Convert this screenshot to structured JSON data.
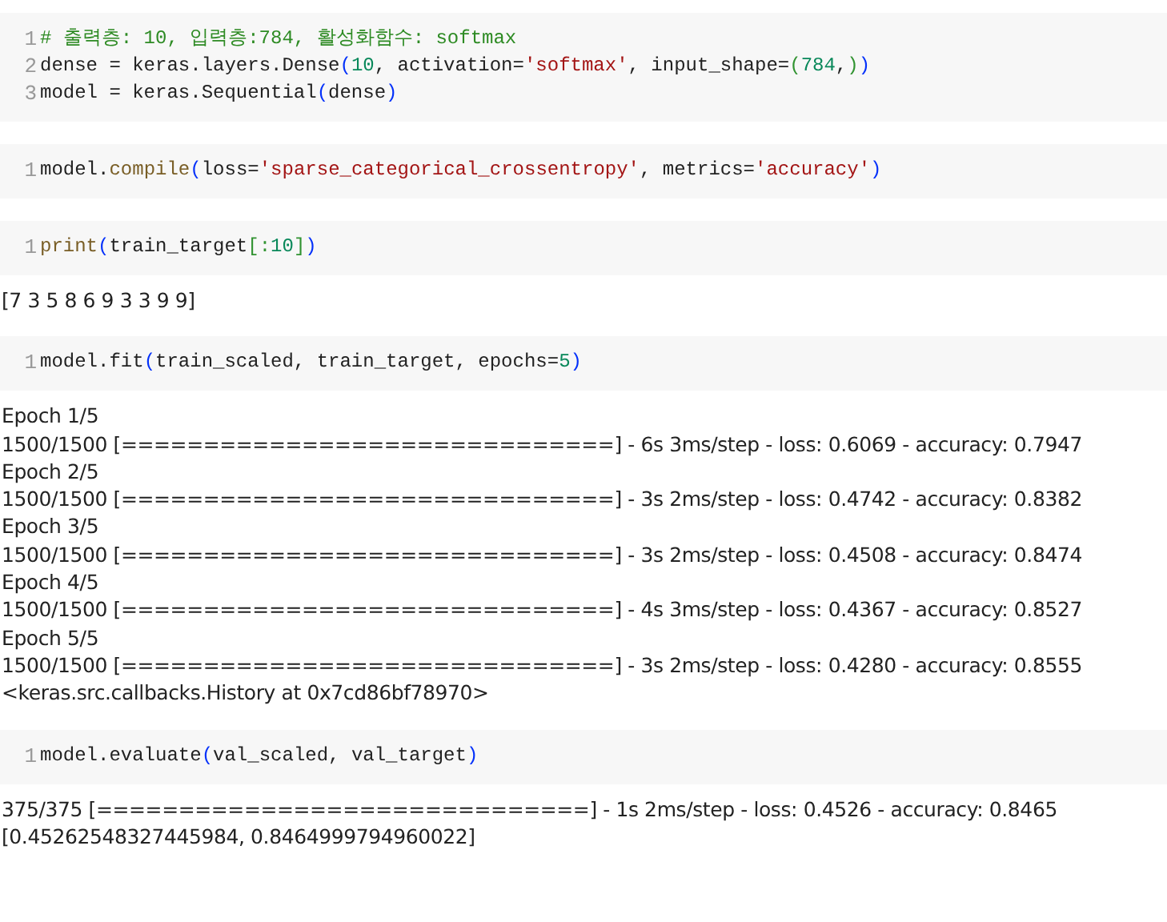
{
  "cells": [
    {
      "code": [
        [
          {
            "kind": "comment",
            "text": "# 출력층: 10, 입력층:784, 활성화함수: softmax"
          }
        ],
        [
          {
            "kind": "plain",
            "text": "dense = keras.layers.Dense"
          },
          {
            "kind": "bracket",
            "text": "("
          },
          {
            "kind": "number",
            "text": "10"
          },
          {
            "kind": "plain",
            "text": ", activation="
          },
          {
            "kind": "string",
            "text": "'softmax'"
          },
          {
            "kind": "plain",
            "text": ", input_shape="
          },
          {
            "kind": "bracket2",
            "text": "("
          },
          {
            "kind": "number",
            "text": "784"
          },
          {
            "kind": "plain",
            "text": ","
          },
          {
            "kind": "bracket2",
            "text": ")"
          },
          {
            "kind": "bracket",
            "text": ")"
          }
        ],
        [
          {
            "kind": "plain",
            "text": "model = keras.Sequential"
          },
          {
            "kind": "bracket",
            "text": "("
          },
          {
            "kind": "plain",
            "text": "dense"
          },
          {
            "kind": "bracket",
            "text": ")"
          }
        ]
      ],
      "line_numbers": [
        "1",
        "2",
        "3"
      ]
    },
    {
      "code": [
        [
          {
            "kind": "plain",
            "text": "model."
          },
          {
            "kind": "function",
            "text": "compile"
          },
          {
            "kind": "bracket",
            "text": "("
          },
          {
            "kind": "plain",
            "text": "loss="
          },
          {
            "kind": "string",
            "text": "'sparse_categorical_crossentropy'"
          },
          {
            "kind": "plain",
            "text": ", metrics="
          },
          {
            "kind": "string",
            "text": "'accuracy'"
          },
          {
            "kind": "bracket",
            "text": ")"
          }
        ]
      ],
      "line_numbers": [
        "1"
      ]
    },
    {
      "code": [
        [
          {
            "kind": "function",
            "text": "print"
          },
          {
            "kind": "bracket",
            "text": "("
          },
          {
            "kind": "plain",
            "text": "train_target"
          },
          {
            "kind": "bracket2",
            "text": "[:"
          },
          {
            "kind": "number",
            "text": "10"
          },
          {
            "kind": "bracket2",
            "text": "]"
          },
          {
            "kind": "bracket",
            "text": ")"
          }
        ]
      ],
      "line_numbers": [
        "1"
      ],
      "output": [
        "[7 3 5 8 6 9 3 3 9 9]"
      ]
    },
    {
      "code": [
        [
          {
            "kind": "plain",
            "text": "model.fit"
          },
          {
            "kind": "bracket",
            "text": "("
          },
          {
            "kind": "plain",
            "text": "train_scaled, train_target, epochs="
          },
          {
            "kind": "number",
            "text": "5"
          },
          {
            "kind": "bracket",
            "text": ")"
          }
        ]
      ],
      "line_numbers": [
        "1"
      ],
      "output": [
        "Epoch 1/5",
        "1500/1500 [==============================] - 6s 3ms/step - loss: 0.6069 - accuracy: 0.7947",
        "Epoch 2/5",
        "1500/1500 [==============================] - 3s 2ms/step - loss: 0.4742 - accuracy: 0.8382",
        "Epoch 3/5",
        "1500/1500 [==============================] - 3s 2ms/step - loss: 0.4508 - accuracy: 0.8474",
        "Epoch 4/5",
        "1500/1500 [==============================] - 4s 3ms/step - loss: 0.4367 - accuracy: 0.8527",
        "Epoch 5/5",
        "1500/1500 [==============================] - 3s 2ms/step - loss: 0.4280 - accuracy: 0.8555",
        "<keras.src.callbacks.History at 0x7cd86bf78970>"
      ]
    },
    {
      "code": [
        [
          {
            "kind": "plain",
            "text": "model.evaluate"
          },
          {
            "kind": "bracket",
            "text": "("
          },
          {
            "kind": "plain",
            "text": "val_scaled, val_target"
          },
          {
            "kind": "bracket",
            "text": ")"
          }
        ]
      ],
      "line_numbers": [
        "1"
      ],
      "output": [
        "375/375 [==============================] - 1s 2ms/step - loss: 0.4526 - accuracy: 0.8465",
        "[0.45262548327445984, 0.8464999794960022]"
      ]
    }
  ]
}
